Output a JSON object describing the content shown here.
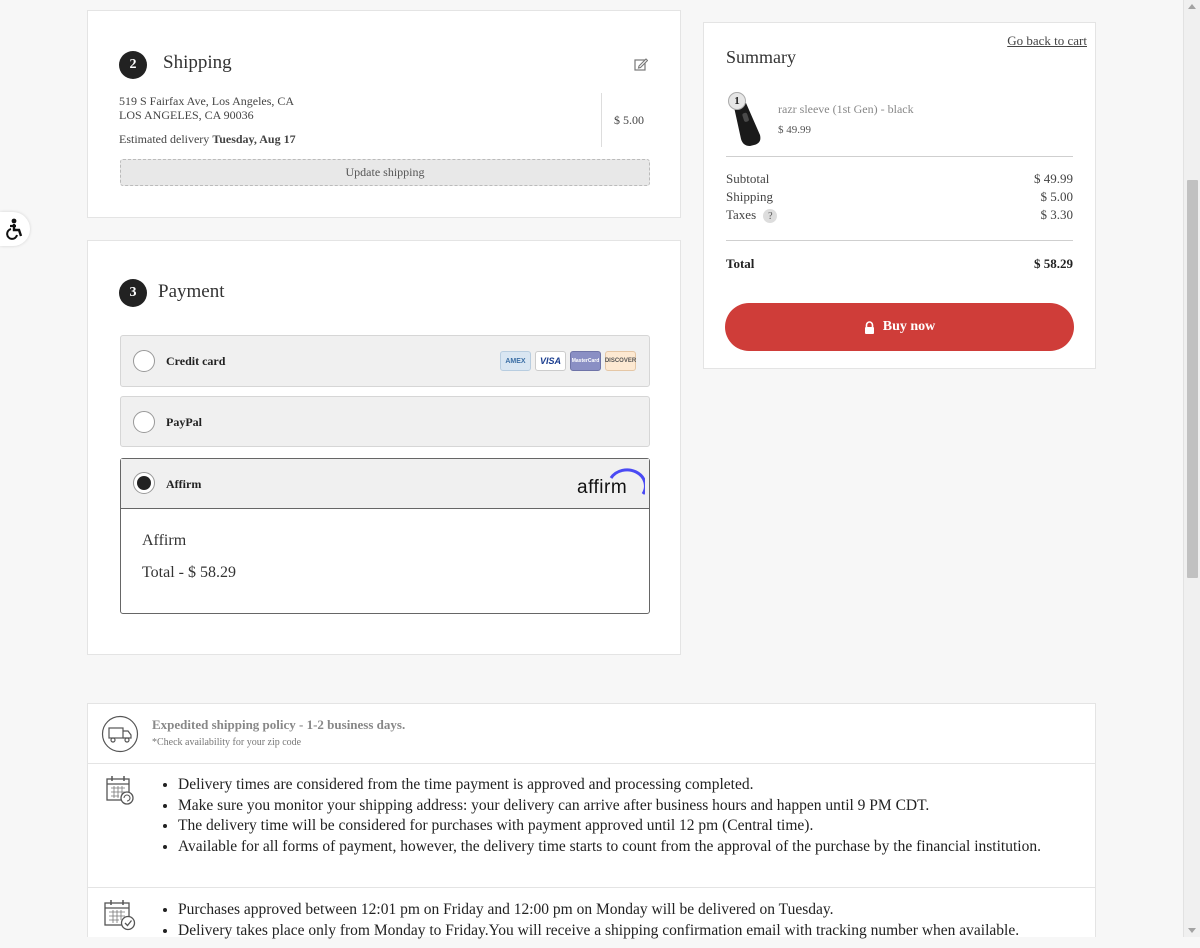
{
  "accessibility": {
    "icon": "accessibility-icon"
  },
  "shipping": {
    "step": "2",
    "title": "Shipping",
    "address_line1": "519 S Fairfax Ave, Los Angeles, CA",
    "address_line2": "LOS ANGELES, CA 90036",
    "estimated_prefix": "Estimated delivery ",
    "estimated_date": "Tuesday, Aug 17",
    "price": "$ 5.00",
    "update_label": "Update shipping"
  },
  "payment": {
    "step": "3",
    "title": "Payment",
    "options": [
      {
        "label": "Credit card",
        "selected": false
      },
      {
        "label": "PayPal",
        "selected": false
      },
      {
        "label": "Affirm",
        "selected": true
      }
    ],
    "card_brands": [
      "AMEX",
      "VISA",
      "MasterCard",
      "DISCOVER"
    ],
    "affirm_logo": "affirm",
    "affirm_title": "Affirm",
    "affirm_total": "Total - $ 58.29"
  },
  "summary": {
    "title": "Summary",
    "back_link": "Go back to cart",
    "item": {
      "qty": "1",
      "name": "razr sleeve (1st Gen) - black",
      "price": "$ 49.99"
    },
    "subtotal_label": "Subtotal",
    "subtotal": "$ 49.99",
    "shipping_label": "Shipping",
    "shipping": "$ 5.00",
    "taxes_label": "Taxes",
    "taxes_help": "?",
    "taxes": "$ 3.30",
    "total_label": "Total",
    "total": "$ 58.29",
    "buy_label": "Buy now"
  },
  "policy": {
    "title": "Expedited shipping policy - 1-2 business days.",
    "subtitle": "*Check availability for your zip code",
    "block1": [
      "Delivery times are considered from the time payment is approved and processing completed.",
      "Make sure you monitor your shipping address: your delivery can arrive after business hours and happen until 9 PM CDT.",
      "The delivery time will be considered for purchases with payment approved until 12 pm (Central time).",
      "Available for all forms of payment, however, the delivery time starts to count from the approval of the purchase by the financial institution."
    ],
    "block2": [
      "Purchases approved between 12:01 pm on Friday and 12:00 pm on Monday will be delivered on Tuesday.",
      "Delivery takes place only from Monday to Friday.You will receive a shipping confirmation email with tracking number when available."
    ]
  }
}
